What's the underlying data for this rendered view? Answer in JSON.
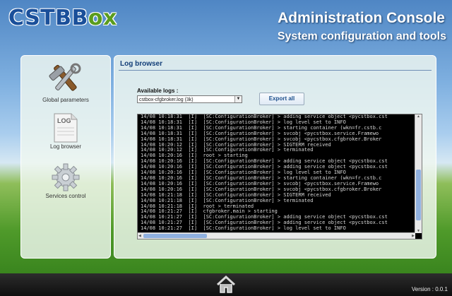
{
  "header": {
    "logo_main": "CSTB",
    "logo_suffix": "ox",
    "title": "Administration Console",
    "subtitle": "System configuration and tools"
  },
  "sidebar": {
    "items": [
      {
        "label": "Global parameters",
        "icon": "tools-icon"
      },
      {
        "label": "Log browser",
        "icon": "log-icon",
        "icon_text": "LOG"
      },
      {
        "label": "Services control",
        "icon": "gear-icon"
      }
    ]
  },
  "main": {
    "title": "Log browser",
    "logs_label": "Available logs :",
    "selected_log": "cstbox-cfgbroker.log (3k)",
    "export_label": "Export all",
    "log_lines": [
      "14/08 10:18:31  [I]  [SC:ConfigurationBroker] > adding service object <pycstbox.cst",
      "14/08 10:18:31  [I]  [SC:ConfigurationBroker] > log level set to INFO",
      "14/08 10:18:31  [I]  [SC:ConfigurationBroker] > starting container (wkn=fr.cstb.c",
      "14/08 10:18:31  [I]  [SC:ConfigurationBroker] > svcobj <pycstbox.service.Framewo",
      "14/08 10:18:31  [I]  [SC:ConfigurationBroker] > svcobj <pycstbox.cfgbroker.Broker",
      "14/08 10:20:12  [I]  [SC:ConfigurationBroker] > SIGTERM received",
      "14/08 10:20:12  [I]  [SC:ConfigurationBroker] > terminated",
      "14/08 10:20:16  [I]  root > starting",
      "14/08 10:20:16  [I]  [SC:ConfigurationBroker] > adding service object <pycstbox.cst",
      "14/08 10:20:16  [I]  [SC:ConfigurationBroker] > adding service object <pycstbox.cst",
      "14/08 10:20:16  [I]  [SC:ConfigurationBroker] > log level set to INFO",
      "14/08 10:20:16  [I]  [SC:ConfigurationBroker] > starting container (wkn=fr.cstb.c",
      "14/08 10:20:16  [I]  [SC:ConfigurationBroker] > svcobj <pycstbox.service.Framewo",
      "14/08 10:20:16  [I]  [SC:ConfigurationBroker] > svcobj <pycstbox.cfgbroker.Broker",
      "14/08 10:21:18  [I]  [SC:ConfigurationBroker] > SIGTERM received",
      "14/08 10:21:18  [I]  [SC:ConfigurationBroker] > terminated",
      "14/08 10:21:18  [I]  root > terminated",
      "14/08 10:21:27  [I]  cfgbroker.main > starting",
      "14/08 10:21:27  [I]  [SC:ConfigurationBroker] > adding service object <pycstbox.cst",
      "14/08 10:21:27  [I]  [SC:ConfigurationBroker] > adding service object <pycstbox.cst",
      "14/08 10:21:27  [I]  [SC:ConfigurationBroker] > log level set to INFO"
    ],
    "log_scroll_fraction": 0.55
  },
  "footer": {
    "home_icon": "home-icon",
    "version": "Version : 0.0.1"
  },
  "colors": {
    "logo_blue": "#1a4f9a",
    "logo_green": "#5a9c1e",
    "panel_title": "#123e78"
  }
}
